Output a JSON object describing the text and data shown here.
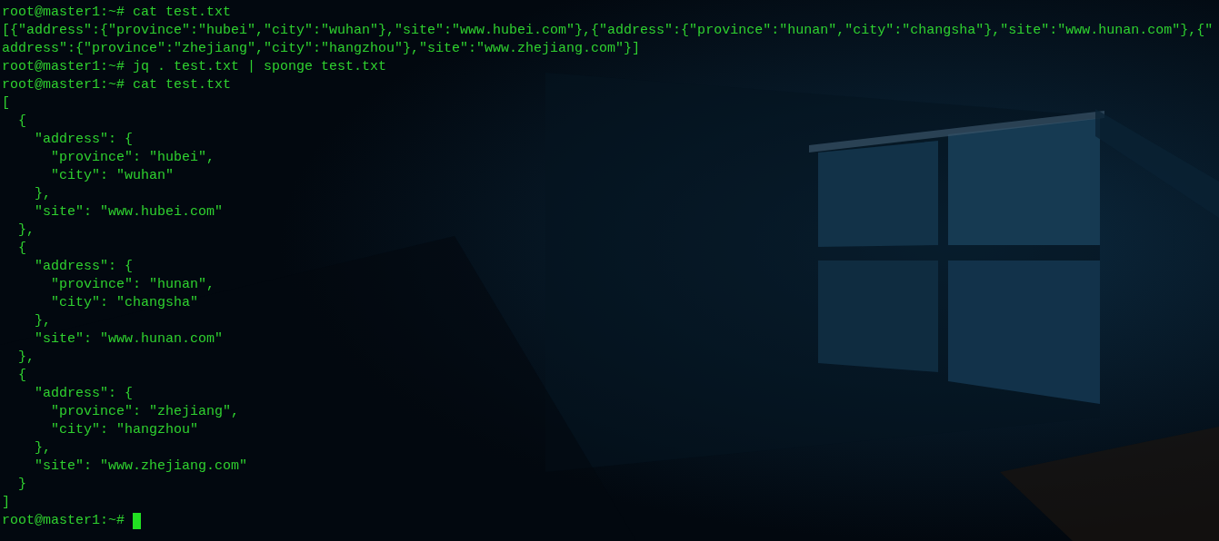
{
  "terminal": {
    "lines": [
      {
        "kind": "prompt",
        "prompt": "root@master1:~#",
        "command": "cat test.txt",
        "cursor": false
      },
      {
        "kind": "output",
        "text": "[{\"address\":{\"province\":\"hubei\",\"city\":\"wuhan\"},\"site\":\"www.hubei.com\"},{\"address\":{\"province\":\"hunan\",\"city\":\"changsha\"},\"site\":\"www.hunan.com\"},{\""
      },
      {
        "kind": "output",
        "text": "address\":{\"province\":\"zhejiang\",\"city\":\"hangzhou\"},\"site\":\"www.zhejiang.com\"}]"
      },
      {
        "kind": "prompt",
        "prompt": "root@master1:~#",
        "command": "jq . test.txt | sponge test.txt",
        "cursor": false
      },
      {
        "kind": "prompt",
        "prompt": "root@master1:~#",
        "command": "cat test.txt",
        "cursor": false
      },
      {
        "kind": "output",
        "text": "["
      },
      {
        "kind": "output",
        "text": "  {"
      },
      {
        "kind": "output",
        "text": "    \"address\": {"
      },
      {
        "kind": "output",
        "text": "      \"province\": \"hubei\","
      },
      {
        "kind": "output",
        "text": "      \"city\": \"wuhan\""
      },
      {
        "kind": "output",
        "text": "    },"
      },
      {
        "kind": "output",
        "text": "    \"site\": \"www.hubei.com\""
      },
      {
        "kind": "output",
        "text": "  },"
      },
      {
        "kind": "output",
        "text": "  {"
      },
      {
        "kind": "output",
        "text": "    \"address\": {"
      },
      {
        "kind": "output",
        "text": "      \"province\": \"hunan\","
      },
      {
        "kind": "output",
        "text": "      \"city\": \"changsha\""
      },
      {
        "kind": "output",
        "text": "    },"
      },
      {
        "kind": "output",
        "text": "    \"site\": \"www.hunan.com\""
      },
      {
        "kind": "output",
        "text": "  },"
      },
      {
        "kind": "output",
        "text": "  {"
      },
      {
        "kind": "output",
        "text": "    \"address\": {"
      },
      {
        "kind": "output",
        "text": "      \"province\": \"zhejiang\","
      },
      {
        "kind": "output",
        "text": "      \"city\": \"hangzhou\""
      },
      {
        "kind": "output",
        "text": "    },"
      },
      {
        "kind": "output",
        "text": "    \"site\": \"www.zhejiang.com\""
      },
      {
        "kind": "output",
        "text": "  }"
      },
      {
        "kind": "output",
        "text": "]"
      },
      {
        "kind": "prompt",
        "prompt": "root@master1:~#",
        "cursor": true
      }
    ]
  }
}
